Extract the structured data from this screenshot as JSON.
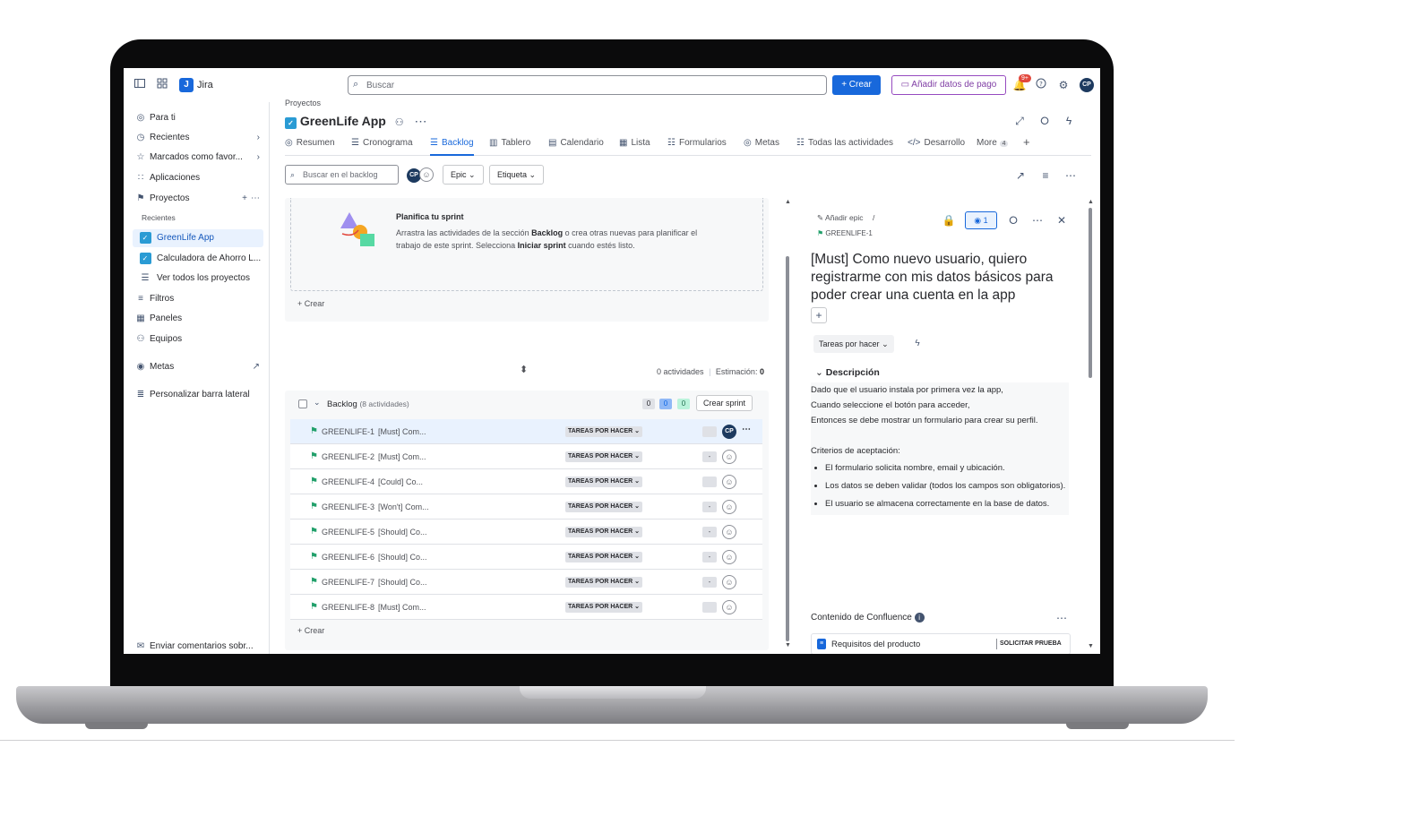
{
  "topbar": {
    "app_name": "Jira",
    "search_placeholder": "Buscar",
    "create_label": "+ Crear",
    "pay_label": "Añadir datos de pago",
    "notif_count": "9+",
    "avatar_initials": "CP"
  },
  "sidebar": {
    "items": [
      {
        "label": "Para ti",
        "icon": "user-icon"
      },
      {
        "label": "Recientes",
        "icon": "clock-icon"
      },
      {
        "label": "Marcados como favor...",
        "icon": "star-icon"
      },
      {
        "label": "Aplicaciones",
        "icon": "apps-icon"
      },
      {
        "label": "Proyectos",
        "icon": "projects-icon"
      }
    ],
    "recent_header": "Recientes",
    "projects": [
      "GreenLife App",
      "Calculadora de Ahorro L..."
    ],
    "view_all": "Ver todos los proyectos",
    "more_items": [
      "Filtros",
      "Paneles",
      "Equipos"
    ],
    "metas": "Metas",
    "customize": "Personalizar barra lateral",
    "feedback": "Enviar comentarios sobr..."
  },
  "main": {
    "breadcrumb": "Proyectos",
    "title": "GreenLife App",
    "tabs": [
      "Resumen",
      "Cronograma",
      "Backlog",
      "Tablero",
      "Calendario",
      "Lista",
      "Formularios",
      "Metas",
      "Todas las actividades",
      "Desarrollo",
      "More"
    ],
    "more_count": "4",
    "backlog_search_placeholder": "Buscar en el backlog",
    "filter_epic": "Epic",
    "filter_label": "Etiqueta"
  },
  "sprint": {
    "title": "Planifica tu sprint",
    "desc_1": "Arrastra las actividades de la sección ",
    "desc_bold1": "Backlog",
    "desc_2": " o crea otras nuevas para planificar el trabajo de este sprint. Selecciona ",
    "desc_bold2": "Iniciar sprint",
    "desc_3": " cuando estés listo.",
    "create": "+ Crear",
    "activities": "0 actividades",
    "estimation_label": "Estimación:",
    "estimation_value": "0"
  },
  "backlog": {
    "title": "Backlog",
    "count": "(8 actividades)",
    "pills": [
      "0",
      "0",
      "0"
    ],
    "create_sprint": "Crear sprint",
    "create": "+ Crear",
    "rows": [
      {
        "key": "GREENLIFE-1",
        "summary": "[Must] Com...",
        "status": "TAREAS POR HACER",
        "est": "",
        "assignee": "CP"
      },
      {
        "key": "GREENLIFE-2",
        "summary": "[Must] Com...",
        "status": "TAREAS POR HACER",
        "est": "-",
        "assignee": ""
      },
      {
        "key": "GREENLIFE-4",
        "summary": "[Could] Co...",
        "status": "TAREAS POR HACER",
        "est": "",
        "assignee": ""
      },
      {
        "key": "GREENLIFE-3",
        "summary": "[Won't] Com...",
        "status": "TAREAS POR HACER",
        "est": "-",
        "assignee": ""
      },
      {
        "key": "GREENLIFE-5",
        "summary": "[Should] Co...",
        "status": "TAREAS POR HACER",
        "est": "-",
        "assignee": ""
      },
      {
        "key": "GREENLIFE-6",
        "summary": "[Should] Co...",
        "status": "TAREAS POR HACER",
        "est": "-",
        "assignee": ""
      },
      {
        "key": "GREENLIFE-7",
        "summary": "[Should] Co...",
        "status": "TAREAS POR HACER",
        "est": "-",
        "assignee": ""
      },
      {
        "key": "GREENLIFE-8",
        "summary": "[Must] Com...",
        "status": "TAREAS POR HACER",
        "est": "",
        "assignee": ""
      }
    ]
  },
  "detail": {
    "add_epic": "Añadir epic",
    "separator": "/",
    "issue_key": "GREENLIFE-1",
    "watchers": "1",
    "title": "[Must] Como nuevo usuario, quiero registrarme con mis datos básicos para poder crear una cuenta en la app",
    "status": "Tareas por hacer",
    "description_header": "Descripción",
    "desc_lines": [
      "Dado que el usuario instala por primera vez la app,",
      "Cuando seleccione el botón para acceder,",
      "Entonces se debe mostrar un formulario para crear su perfil."
    ],
    "criteria_title": "Criterios de aceptación:",
    "criteria": [
      "El formulario solicita nombre, email y ubicación.",
      "Los datos se deben validar (todos los campos son obligatorios).",
      "El usuario se almacena correctamente en la base de datos."
    ],
    "confluence_header": "Contenido de Confluence",
    "confluence_item": "Requisitos del producto",
    "confluence_action": "SOLICITAR PRUEBA"
  },
  "colors": {
    "brand_blue": "#1868db",
    "pay_purple": "#803fa5",
    "story_green": "#22a06b",
    "notif_red": "#e2483d"
  }
}
